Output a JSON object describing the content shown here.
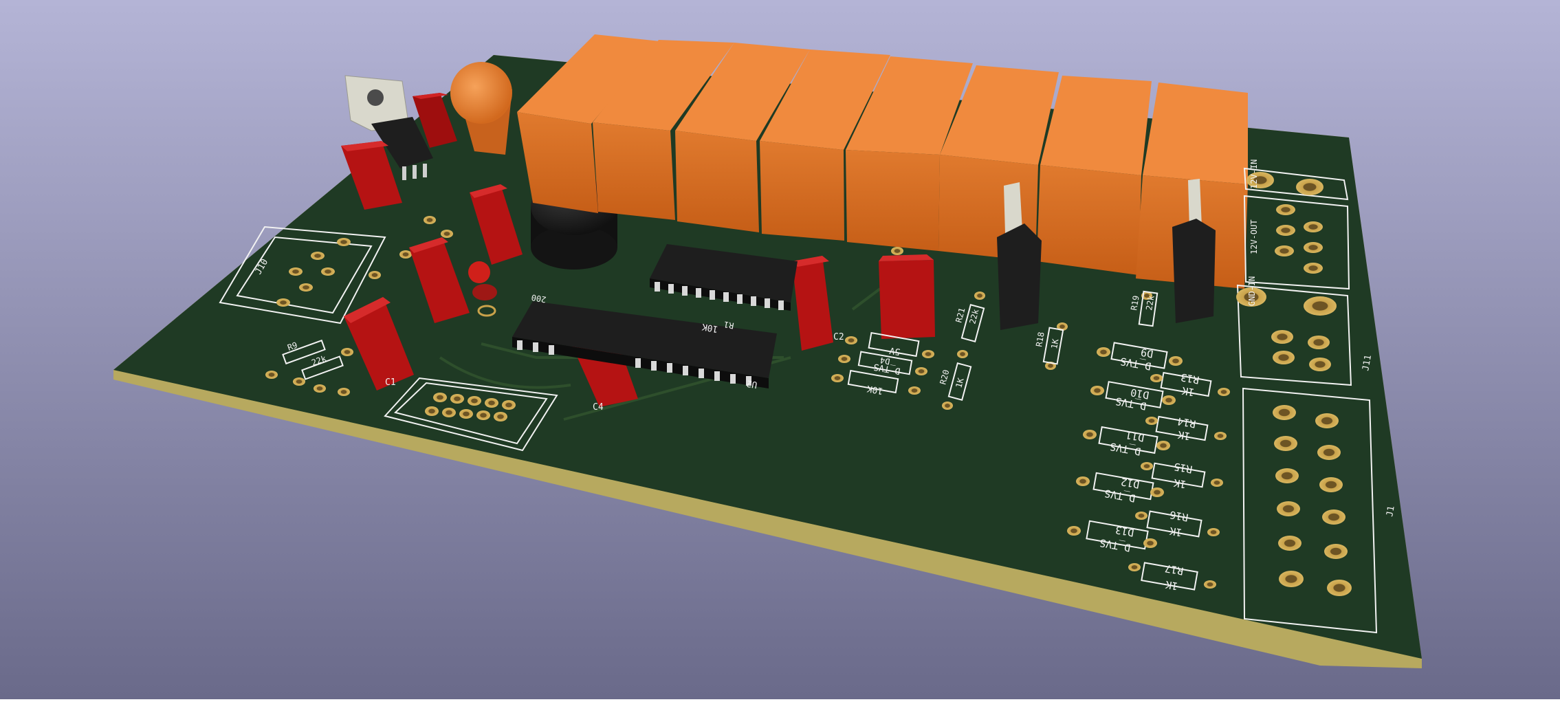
{
  "colors": {
    "bg_top": "#b4b4d6",
    "bg_bottom": "#6a6a8a",
    "pcb": "#1f3a24",
    "pcb_edge": "#c2b56a",
    "silk": "#f2f2f2",
    "pad": "#c9a24a",
    "relay": "#d2691e",
    "capacitor": "#b51313",
    "ic": "#1e1e1e"
  },
  "labels": {
    "c2": "C2",
    "c4": "C4",
    "c1": "C1",
    "u2": "U2",
    "r1_val": "10K",
    "r1": "R1",
    "r200": "200",
    "zener": "5V",
    "d4": "D4",
    "dtvs": "D_TVS",
    "r10k": "10K",
    "r20": "R20",
    "r21": "R21",
    "r21_val": "22k",
    "r18": "R18",
    "r1k": "1K",
    "r19": "R19",
    "r19_val": "22k",
    "j10": "J10",
    "j11": "J11",
    "j1": "J1",
    "r9": "R9",
    "r22k": "22k",
    "d9": "D9",
    "d10": "D10",
    "d11": "D11",
    "d12": "D12",
    "d13": "D13",
    "r13": "R13",
    "r14": "R14",
    "r15": "R15",
    "r16": "R16",
    "r17": "R17",
    "k1": "1K",
    "hdr1": "12V-IN",
    "hdr2": "12V-OUT",
    "hdr3": "GND-IN"
  }
}
